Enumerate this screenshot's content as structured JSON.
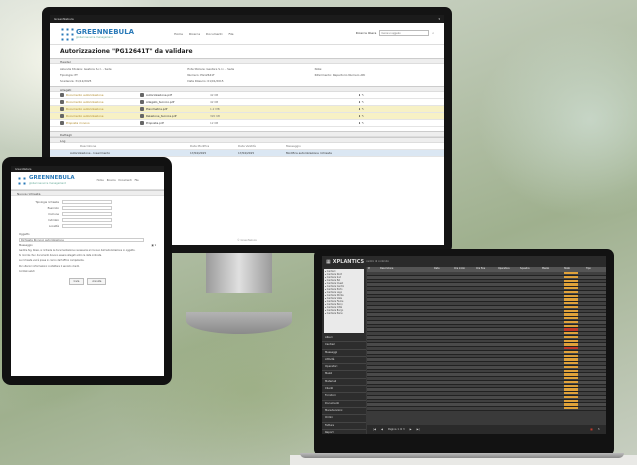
{
  "monitor": {
    "app_name": "GreenNebula",
    "logo_text": "GREENNEBULA",
    "logo_tagline": "global resource management",
    "nav": [
      "Home",
      "Ricerca",
      "Documenti",
      "File"
    ],
    "search_label": "Ricerca libera",
    "search_placeholder": "Cerca un oggetto",
    "title": "Autorizzazione \"PG12641T\" da validare",
    "section_header": "Header",
    "fields": [
      "Azienda titolare: Gestore S.r.l. - Sede",
      "Ente titolare: Gestore S.r.l. - Sede",
      "Note:",
      "Tipologia: PT",
      "Numero: PG12641T",
      "Riferimento: Repertorio Numero Atti",
      "Scadenza: 31/12/2025",
      "Data Rilascio: 01/01/2015",
      ""
    ],
    "section_allegati": "Allegati",
    "attachments": [
      {
        "name": "Documento autorizzazione",
        "file": "Autorizzazione.pdf",
        "size": "42 KB",
        "note": "",
        "y": false
      },
      {
        "name": "Documento autorizzazione",
        "file": "Allegato_tecnico.pdf",
        "size": "42 KB",
        "note": "",
        "y": false
      },
      {
        "name": "Documento autorizzazione",
        "file": "Planimetria.pdf",
        "size": "1.2 MB",
        "note": "",
        "y": true
      },
      {
        "name": "Documento autorizzazione",
        "file": "Relazione_tecnica.pdf",
        "size": "320 KB",
        "note": "",
        "y": true
      },
      {
        "name": "Proposta rinnovo",
        "file": "Proposta.pdf",
        "size": "12 KB",
        "note": "",
        "y": false
      }
    ],
    "section_notes": "Dettagli",
    "section_log": "Log",
    "log_headers": [
      "Descrizione",
      "Data Modifica",
      "Data Validità",
      "Messaggio"
    ],
    "log_rows": [
      {
        "desc": "Autorizzazione - Inserimento",
        "date": "17/04/2015",
        "valid": "17/04/2015",
        "msg": "Modifica autorizzazione richiesta"
      }
    ],
    "footer": "© GreenNebula"
  },
  "tablet": {
    "section": "Nuova richiesta",
    "fields": [
      [
        "Tipologia richiesta",
        ""
      ],
      [
        "Esercizio",
        ""
      ],
      [
        "Comune",
        "",
        ""
      ],
      [
        "Indirizzo",
        ""
      ],
      [
        "Località",
        ""
      ]
    ],
    "oggetto_label": "Oggetto",
    "oggetto_value": "Richiesta Rinnovo autorizzazione",
    "message_label": "Messaggio",
    "message_text": [
      "Gentile Sig. Rossi, si richiede la documentazione necessaria al rinnovo dell'autorizzazione in oggetto.",
      "Si ricorda che i documenti devono essere allegati entro la data indicata.",
      "La richiesta verrà presa in carico dall'ufficio competente.",
      "Per ulteriori informazioni contattare il servizio clienti.",
      "Cordiali saluti"
    ],
    "buttons": [
      "Invia",
      "Annulla"
    ]
  },
  "laptop": {
    "brand": "XPLANTICS",
    "brand_small": "centro di controllo",
    "menu_items": [
      "Alberi",
      "Cantieri",
      "Messaggi",
      "Attività",
      "Operatori",
      "Mezzi",
      "Materiali",
      "Clienti",
      "Fornitori",
      "Documenti",
      "Manutenzioni",
      "Ordini",
      "Fatture",
      "Report",
      "Impostazioni",
      "Utenti",
      "Gruppi",
      "Esci"
    ],
    "tree_lines": [
      "Cantieri",
      "Cantiere Nord",
      "Cantiere Sud",
      "Cantiere Est",
      "Cantiere Ovest",
      "Cantiere Centro",
      "Cantiere Porto",
      "Cantiere Lago",
      "Cantiere Monte",
      "Cantiere Valle",
      "Cantiere Fiume",
      "Cantiere Parco",
      "Cantiere Città",
      "Cantiere Borgo",
      "Cantiere Piano"
    ],
    "grid_headers": [
      "#",
      "Descrizione",
      "Data",
      "Ora inizio",
      "Ora fine",
      "Operatore",
      "Squadra",
      "Mezzo",
      "Stato",
      "Tipo"
    ],
    "grid_row_count": 37,
    "pager": "Pagina 1 di 3"
  }
}
